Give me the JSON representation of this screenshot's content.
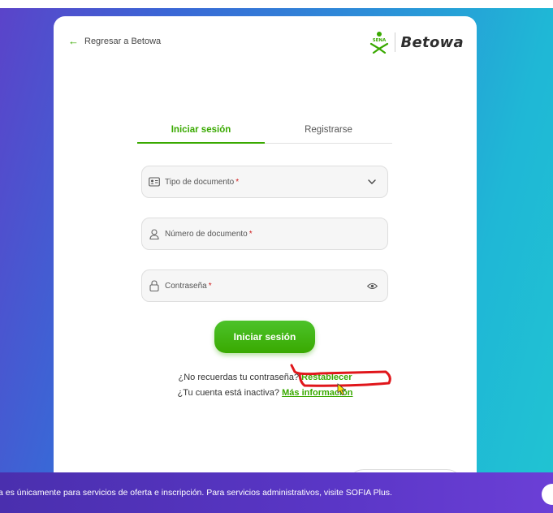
{
  "header": {
    "back_label": "Regresar a Betowa",
    "brand_logo_text": "SENA",
    "brand_name": "Betowa"
  },
  "tabs": [
    {
      "label": "Iniciar sesión",
      "active": true
    },
    {
      "label": "Registrarse",
      "active": false
    }
  ],
  "form": {
    "doc_type_label": "Tipo de documento",
    "doc_number_label": "Número de documento",
    "password_label": "Contraseña",
    "required_mark": "*",
    "submit_label": "Iniciar sesión"
  },
  "help": {
    "forgot_text": "¿No recuerdas tu contraseña?",
    "forgot_link": "Restablecer",
    "inactive_text": "¿Tu cuenta está inactiva?",
    "inactive_link": "Más información"
  },
  "banner": {
    "text": "a es únicamente para servicios de oferta e inscripción. Para servicios administrativos, visite SOFIA Plus."
  },
  "colors": {
    "accent": "#39a900",
    "required": "#d01c1c",
    "banner": "#5a36c6",
    "annotation": "#e0161b"
  },
  "icons": [
    "arrow-left-icon",
    "sena-logo-icon",
    "id-card-icon",
    "chevron-down-icon",
    "user-icon",
    "lock-icon",
    "eye-icon",
    "cursor-icon"
  ]
}
